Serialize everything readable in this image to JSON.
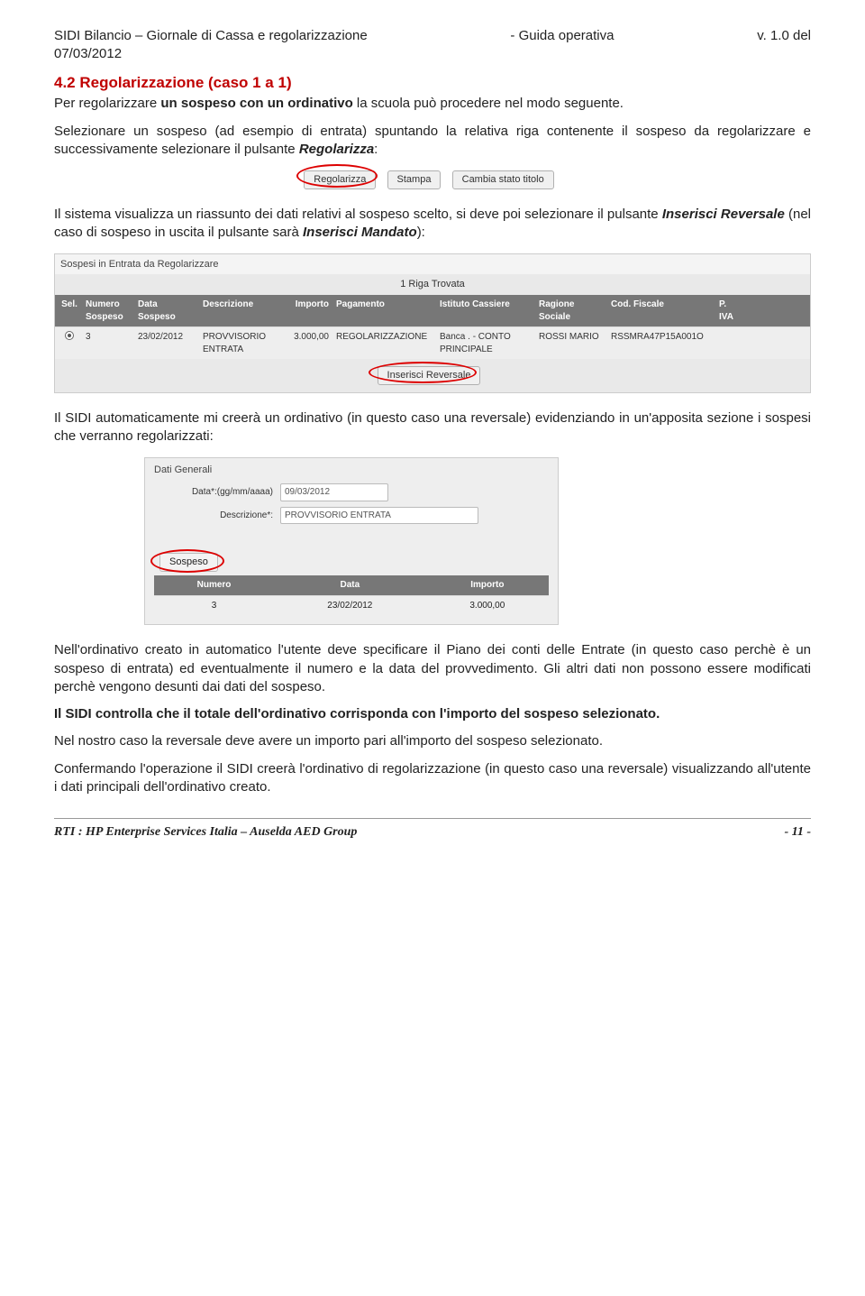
{
  "header": {
    "left": "SIDI Bilancio – Giornale di Cassa e regolarizzazione",
    "center": "- Guida operativa",
    "right": "v. 1.0 del",
    "date": "07/03/2012"
  },
  "section": {
    "number_title": "4.2 Regolarizzazione (caso 1 a 1)",
    "intro_pre": "Per regolarizzare ",
    "intro_bold": "un sospeso con un ordinativo",
    "intro_post": " la scuola può procedere nel modo seguente.",
    "p2_pre": "Selezionare un sospeso (ad esempio di entrata) spuntando la relativa riga contenente il sospeso da regolarizzare e successivamente selezionare il pulsante ",
    "p2_term": "Regolarizza",
    "p2_post": ":"
  },
  "buttons1": {
    "b1": "Regolarizza",
    "b2": "Stampa",
    "b3": "Cambia stato titolo"
  },
  "p3": {
    "pre": "Il sistema visualizza un riassunto dei dati relativi al sospeso scelto, si deve poi selezionare il pulsante ",
    "t1": "Inserisci Reversale",
    "mid": " (nel caso di sospeso in uscita il pulsante sarà ",
    "t2": "Inserisci Mandato",
    "post": "):"
  },
  "table1": {
    "title": "Sospesi in Entrata da Regolarizzare",
    "count": "1 Riga Trovata",
    "headers": {
      "sel": "Sel.",
      "num": "Numero Sospeso",
      "date": "Data Sospeso",
      "desc": "Descrizione",
      "imp": "Importo",
      "pag": "Pagamento",
      "ist": "Istituto Cassiere",
      "rag": "Ragione Sociale",
      "cod": "Cod. Fiscale",
      "iva": "P. IVA"
    },
    "row": {
      "num": "3",
      "date": "23/02/2012",
      "desc": "PROVVISORIO ENTRATA",
      "imp": "3.000,00",
      "pag": "REGOLARIZZAZIONE",
      "ist": "Banca . - CONTO PRINCIPALE",
      "rag": "ROSSI MARIO",
      "cod": "RSSMRA47P15A001O",
      "iva": ""
    },
    "action_btn": "Inserisci Reversale"
  },
  "p4": "Il SIDI automaticamente mi creerà un ordinativo (in questo caso una reversale) evidenziando in un'apposita sezione i sospesi che verranno regolarizzati:",
  "form": {
    "title": "Dati Generali",
    "date_label": "Data*:(gg/mm/aaaa)",
    "date_value": "09/03/2012",
    "desc_label": "Descrizione*:",
    "desc_value": "PROVVISORIO ENTRATA",
    "sospeso_btn": "Sospeso",
    "cols": {
      "num": "Numero",
      "data": "Data",
      "imp": "Importo"
    },
    "row": {
      "num": "3",
      "data": "23/02/2012",
      "imp": "3.000,00"
    }
  },
  "p5": "Nell'ordinativo creato in automatico l'utente deve specificare il Piano dei conti delle Entrate (in questo caso perchè è un sospeso di entrata) ed eventualmente il numero e la data del provvedimento. Gli altri dati non possono essere modificati perchè vengono desunti dai dati del sospeso.",
  "p6": "Il SIDI controlla che il totale dell'ordinativo corrisponda con l'importo del sospeso selezionato.",
  "p7": "Nel nostro caso la reversale deve avere un importo pari all'importo del sospeso selezionato.",
  "p8": "Confermando l'operazione il SIDI creerà l'ordinativo di regolarizzazione (in questo caso una reversale) visualizzando all'utente i dati principali dell'ordinativo creato.",
  "footer": {
    "left": "RTI : HP Enterprise Services Italia – Auselda AED Group",
    "right": "- 11 -"
  }
}
